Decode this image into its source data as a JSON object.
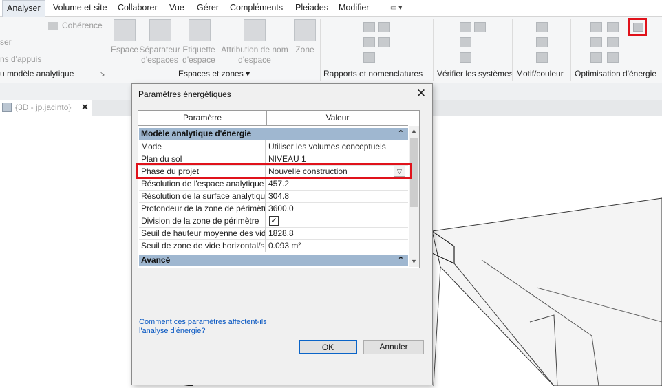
{
  "menu": {
    "tabs": [
      "Analyser",
      "Volume et site",
      "Collaborer",
      "Vue",
      "Gérer",
      "Compléments",
      "Pleiades",
      "Modifier"
    ],
    "active": "Analyser"
  },
  "ribbon": {
    "partial_labels": {
      "a": "ser",
      "b": "ns d'appuis",
      "c": "u modèle analytique"
    },
    "coherence_label": "Cohérence",
    "spaces_tools": [
      {
        "label": "Espace"
      },
      {
        "label": "Séparateur\nd'espaces"
      },
      {
        "label": "Etiquette\nd'espace"
      },
      {
        "label": "Attribution de nom\nd'espace"
      },
      {
        "label": "Zone"
      }
    ],
    "panels": {
      "spaces_zones": "Espaces et zones",
      "reports": "Rapports et nomenclatures",
      "systems": "Vérifier les systèmes",
      "pattern_color": "Motif/couleur",
      "energy": "Optimisation d'énergie"
    }
  },
  "view_tab": {
    "label": "{3D - jp.jacinto}",
    "close": "✕"
  },
  "dialog": {
    "title": "Paramètres énergétiques",
    "close": "✕",
    "columns": {
      "param": "Paramètre",
      "value": "Valeur"
    },
    "groups": [
      {
        "label": "Modèle analytique d'énergie",
        "chevron": "≫"
      },
      {
        "label": "Avancé",
        "chevron": "≫"
      }
    ],
    "rows": [
      {
        "param": "Mode",
        "value": "Utiliser les volumes conceptuels"
      },
      {
        "param": "Plan du sol",
        "value": "NIVEAU 1"
      },
      {
        "param": "Phase du projet",
        "value": "Nouvelle construction"
      },
      {
        "param": "Résolution de l'espace analytique",
        "value": "457.2"
      },
      {
        "param": "Résolution de la surface analytique",
        "value": "304.8"
      },
      {
        "param": "Profondeur de la zone de périmètr",
        "value": "3600.0"
      },
      {
        "param": "Division de la zone de périmètre",
        "value": "✓"
      },
      {
        "param": "Seuil de hauteur moyenne des vide",
        "value": "1828.8"
      },
      {
        "param": "Seuil de zone de vide horizontal/sa",
        "value": "0.093 m²"
      }
    ],
    "help_link": "Comment ces paramètres affectent-ils l'analyse d'énergie?",
    "buttons": {
      "ok": "OK",
      "cancel": "Annuler"
    }
  },
  "colors": {
    "highlight": "#e0121b",
    "group_header": "#9fb7d0",
    "link": "#0a58c2"
  }
}
